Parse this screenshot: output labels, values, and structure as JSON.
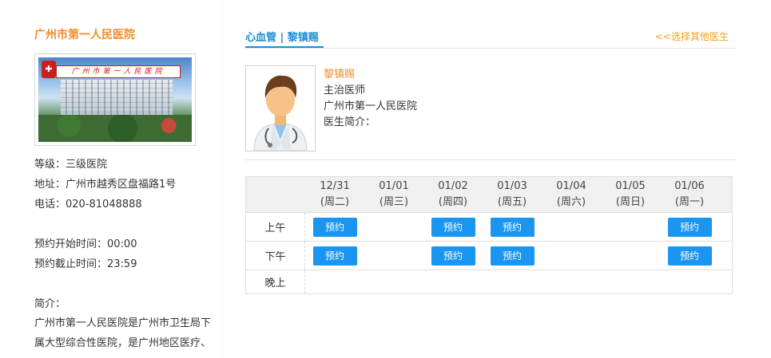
{
  "hospital": {
    "name": "广州市第一人民医院",
    "photo_banner_text": "广州市第一人民医院",
    "level": "等级：三级医院",
    "address": "地址：广州市越秀区盘福路1号",
    "phone": "电话：020-81048888",
    "booking_start": "预约开始时间：00:00",
    "booking_end": "预约截止时间：23:59",
    "intro_label": "简介：",
    "intro_text": "广州市第一人民医院是广州市卫生局下属大型综合性医院，是广州地区医疗、"
  },
  "header": {
    "title": "心血管 | 黎镇赐",
    "back_link": "<<选择其他医生"
  },
  "doctor": {
    "name": "黎镇赐",
    "title": "主治医师",
    "hospital": "广州市第一人民医院",
    "intro_label": "医生简介："
  },
  "schedule": {
    "days": [
      {
        "date": "12/31",
        "weekday": "(周二)"
      },
      {
        "date": "01/01",
        "weekday": "(周三)"
      },
      {
        "date": "01/02",
        "weekday": "(周四)"
      },
      {
        "date": "01/03",
        "weekday": "(周五)"
      },
      {
        "date": "01/04",
        "weekday": "(周六)"
      },
      {
        "date": "01/05",
        "weekday": "(周日)"
      },
      {
        "date": "01/06",
        "weekday": "(周一)"
      }
    ],
    "periods": [
      {
        "label": "上午",
        "available": [
          true,
          false,
          true,
          true,
          false,
          false,
          true
        ]
      },
      {
        "label": "下午",
        "available": [
          true,
          false,
          true,
          true,
          false,
          false,
          true
        ]
      },
      {
        "label": "晚上",
        "available": [
          false,
          false,
          false,
          false,
          false,
          false,
          false
        ]
      }
    ],
    "button_label": "预约"
  },
  "colors": {
    "accent_blue": "#1a8fd6",
    "button_blue": "#1a96f0",
    "orange": "#f08c2b",
    "link_orange": "#f0a020"
  }
}
